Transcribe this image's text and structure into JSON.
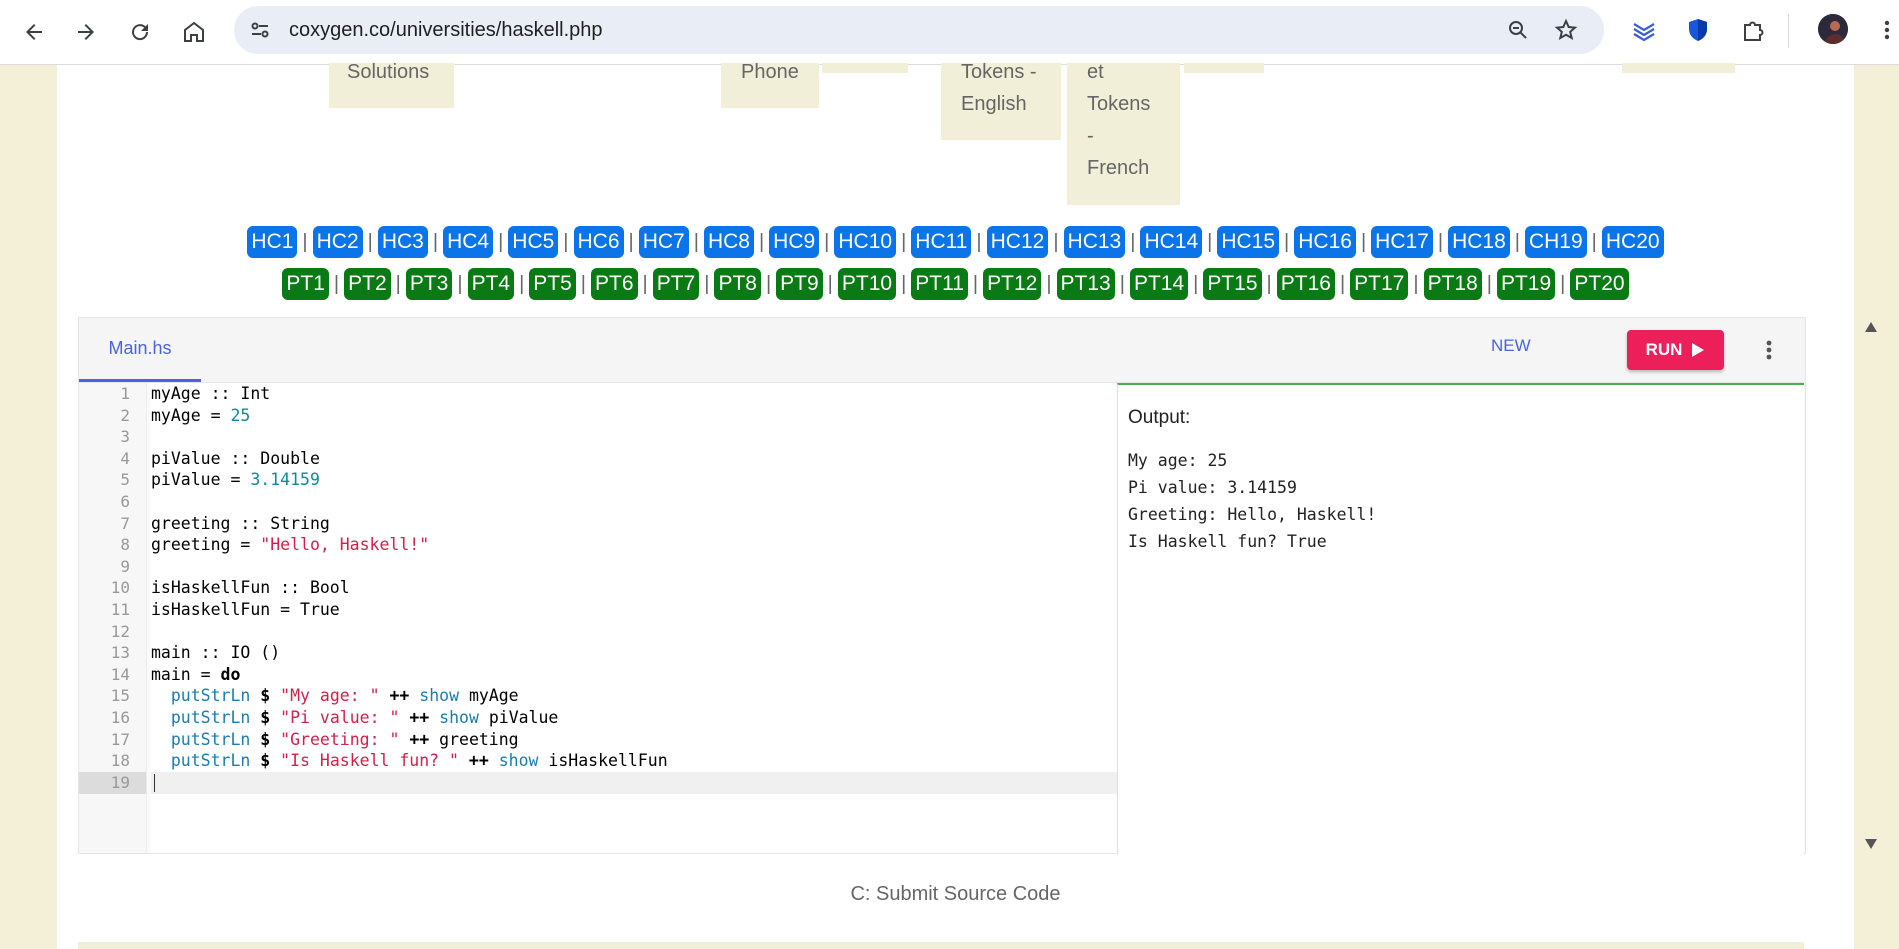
{
  "browser": {
    "url": "coxygen.co/universities/haskell.php",
    "back_icon": "arrow-left-icon",
    "forward_icon": "arrow-right-icon",
    "reload_icon": "reload-icon",
    "home_icon": "home-icon"
  },
  "top_tabs": [
    {
      "label": "Solutions"
    },
    {
      "label": "Phone"
    },
    {
      "label": "Tokens -\nEnglish"
    },
    {
      "label": "et\nTokens\n-\nFrench"
    }
  ],
  "hc_buttons": [
    "HC1",
    "HC2",
    "HC3",
    "HC4",
    "HC5",
    "HC6",
    "HC7",
    "HC8",
    "HC9",
    "HC10",
    "HC11",
    "HC12",
    "HC13",
    "HC14",
    "HC15",
    "HC16",
    "HC17",
    "HC18",
    "CH19",
    "HC20"
  ],
  "pt_buttons": [
    "PT1",
    "PT2",
    "PT3",
    "PT4",
    "PT5",
    "PT6",
    "PT7",
    "PT8",
    "PT9",
    "PT10",
    "PT11",
    "PT12",
    "PT13",
    "PT14",
    "PT15",
    "PT16",
    "PT17",
    "PT18",
    "PT19",
    "PT20"
  ],
  "separator": "|",
  "editor": {
    "file_tab": "Main.hs",
    "new_label": "NEW",
    "run_label": "RUN",
    "line_numbers": [
      "1",
      "2",
      "3",
      "4",
      "5",
      "6",
      "7",
      "8",
      "9",
      "10",
      "11",
      "12",
      "13",
      "14",
      "15",
      "16",
      "17",
      "18",
      "19"
    ],
    "code": [
      [
        {
          "t": "myAge :: Int"
        }
      ],
      [
        {
          "t": "myAge = "
        },
        {
          "t": "25",
          "c": "num"
        }
      ],
      [],
      [
        {
          "t": "piValue :: Double"
        }
      ],
      [
        {
          "t": "piValue = "
        },
        {
          "t": "3.14159",
          "c": "num"
        }
      ],
      [],
      [
        {
          "t": "greeting :: String"
        }
      ],
      [
        {
          "t": "greeting = "
        },
        {
          "t": "\"Hello, Haskell!\"",
          "c": "str"
        }
      ],
      [],
      [
        {
          "t": "isHaskellFun :: Bool"
        }
      ],
      [
        {
          "t": "isHaskellFun = True"
        }
      ],
      [],
      [
        {
          "t": "main :: IO ()"
        }
      ],
      [
        {
          "t": "main = "
        },
        {
          "t": "do",
          "c": "kw"
        }
      ],
      [
        {
          "t": "  "
        },
        {
          "t": "putStrLn",
          "c": "fn"
        },
        {
          "t": " "
        },
        {
          "t": "$",
          "c": "kw"
        },
        {
          "t": " "
        },
        {
          "t": "\"My age: \"",
          "c": "str"
        },
        {
          "t": " "
        },
        {
          "t": "++",
          "c": "kw"
        },
        {
          "t": " "
        },
        {
          "t": "show",
          "c": "fn"
        },
        {
          "t": " myAge"
        }
      ],
      [
        {
          "t": "  "
        },
        {
          "t": "putStrLn",
          "c": "fn"
        },
        {
          "t": " "
        },
        {
          "t": "$",
          "c": "kw"
        },
        {
          "t": " "
        },
        {
          "t": "\"Pi value: \"",
          "c": "str"
        },
        {
          "t": " "
        },
        {
          "t": "++",
          "c": "kw"
        },
        {
          "t": " "
        },
        {
          "t": "show",
          "c": "fn"
        },
        {
          "t": " piValue"
        }
      ],
      [
        {
          "t": "  "
        },
        {
          "t": "putStrLn",
          "c": "fn"
        },
        {
          "t": " "
        },
        {
          "t": "$",
          "c": "kw"
        },
        {
          "t": " "
        },
        {
          "t": "\"Greeting: \"",
          "c": "str"
        },
        {
          "t": " "
        },
        {
          "t": "++",
          "c": "kw"
        },
        {
          "t": " greeting"
        }
      ],
      [
        {
          "t": "  "
        },
        {
          "t": "putStrLn",
          "c": "fn"
        },
        {
          "t": " "
        },
        {
          "t": "$",
          "c": "kw"
        },
        {
          "t": " "
        },
        {
          "t": "\"Is Haskell fun? \"",
          "c": "str"
        },
        {
          "t": " "
        },
        {
          "t": "++",
          "c": "kw"
        },
        {
          "t": " "
        },
        {
          "t": "show",
          "c": "fn"
        },
        {
          "t": " isHaskellFun"
        }
      ],
      []
    ]
  },
  "output": {
    "title": "Output:",
    "lines": [
      "My age: 25",
      "Pi value: 3.14159",
      "Greeting: Hello, Haskell!",
      "Is Haskell fun? True"
    ]
  },
  "footer": {
    "submit_label": "C: Submit Source Code"
  },
  "colors": {
    "hc_blue": "#0b74e8",
    "pt_green": "#0a7a14",
    "run_pink": "#ec1f5b",
    "tab_accent": "#4a63e0"
  }
}
